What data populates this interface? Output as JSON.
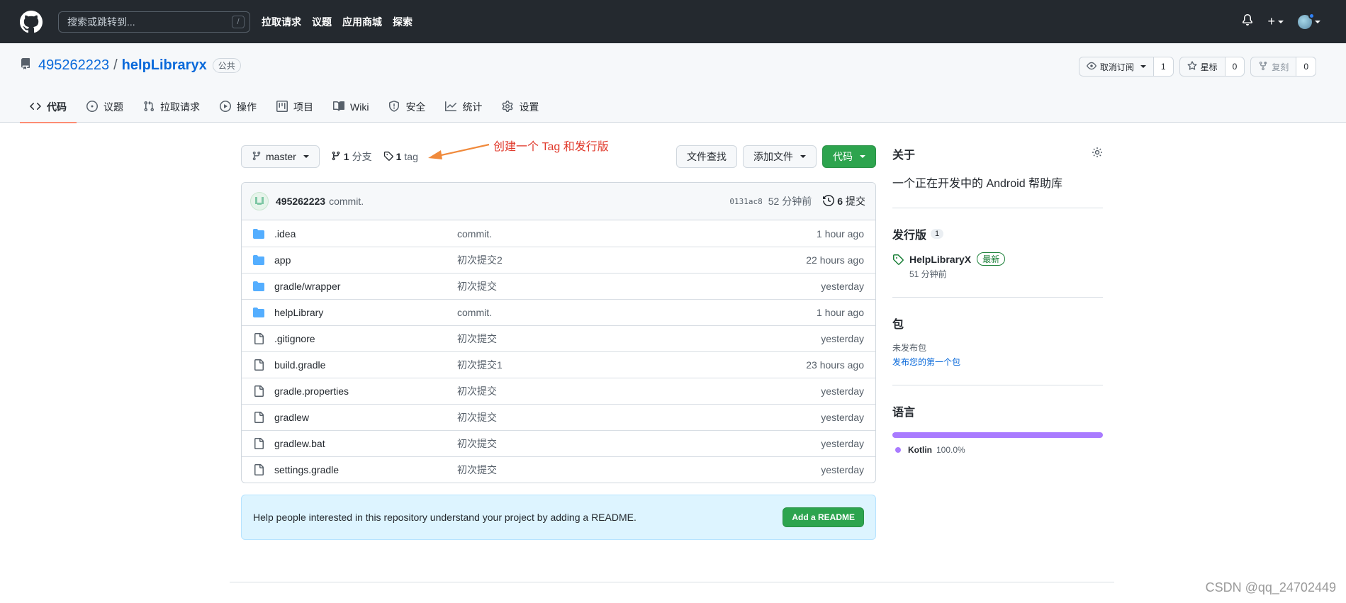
{
  "header": {
    "search_placeholder": "搜索或跳转到...",
    "search_shortcut": "/",
    "nav": [
      "拉取请求",
      "议题",
      "应用商城",
      "探索"
    ],
    "plus_label": "+"
  },
  "repo": {
    "owner": "495262223",
    "separator": "/",
    "name": "helpLibraryx",
    "visibility": "公共",
    "watch_label": "取消订阅",
    "watch_count": "1",
    "star_label": "星标",
    "star_count": "0",
    "fork_label": "复刻",
    "fork_count": "0"
  },
  "tabs": [
    {
      "label": "代码",
      "icon": "code-icon",
      "active": true
    },
    {
      "label": "议题",
      "icon": "issue-icon"
    },
    {
      "label": "拉取请求",
      "icon": "pull-request-icon"
    },
    {
      "label": "操作",
      "icon": "play-icon"
    },
    {
      "label": "项目",
      "icon": "project-icon"
    },
    {
      "label": "Wiki",
      "icon": "book-icon"
    },
    {
      "label": "安全",
      "icon": "shield-icon"
    },
    {
      "label": "统计",
      "icon": "graph-icon"
    },
    {
      "label": "设置",
      "icon": "gear-icon"
    }
  ],
  "branchbar": {
    "branch": "master",
    "branches_count": "1",
    "branches_label": "分支",
    "tags_count": "1",
    "tags_label": "tag",
    "annotation": "创建一个 Tag 和发行版",
    "find_file": "文件查找",
    "add_file": "添加文件",
    "code_button": "代码"
  },
  "latest_commit": {
    "author": "495262223",
    "message": "commit.",
    "sha": "0131ac8",
    "time": "52 分钟前",
    "commits_count": "6",
    "commits_label": "提交"
  },
  "files": [
    {
      "type": "dir",
      "name": ".idea",
      "message": "commit.",
      "age": "1 hour ago"
    },
    {
      "type": "dir",
      "name": "app",
      "message": "初次提交2",
      "age": "22 hours ago"
    },
    {
      "type": "dir",
      "name": "gradle/wrapper",
      "message": "初次提交",
      "age": "yesterday"
    },
    {
      "type": "dir",
      "name": "helpLibrary",
      "message": "commit.",
      "age": "1 hour ago"
    },
    {
      "type": "file",
      "name": ".gitignore",
      "message": "初次提交",
      "age": "yesterday"
    },
    {
      "type": "file",
      "name": "build.gradle",
      "message": "初次提交1",
      "age": "23 hours ago"
    },
    {
      "type": "file",
      "name": "gradle.properties",
      "message": "初次提交",
      "age": "yesterday"
    },
    {
      "type": "file",
      "name": "gradlew",
      "message": "初次提交",
      "age": "yesterday"
    },
    {
      "type": "file",
      "name": "gradlew.bat",
      "message": "初次提交",
      "age": "yesterday"
    },
    {
      "type": "file",
      "name": "settings.gradle",
      "message": "初次提交",
      "age": "yesterday"
    }
  ],
  "readme_banner": {
    "text": "Help people interested in this repository understand your project by adding a README.",
    "button": "Add a README"
  },
  "sidebar": {
    "about_title": "关于",
    "about_desc": "一个正在开发中的 Android 帮助库",
    "releases_title": "发行版",
    "releases_count": "1",
    "release_name": "HelpLibraryX",
    "release_badge": "最新",
    "release_time": "51 分钟前",
    "packages_title": "包",
    "packages_none": "未发布包",
    "packages_link": "发布您的第一个包",
    "languages_title": "语言",
    "language_name": "Kotlin",
    "language_pct": "100.0%",
    "language_color": "#a97bff"
  },
  "watermark": "CSDN @qq_24702449",
  "colors": {
    "header_bg": "#24292f",
    "accent_green": "#2da44e",
    "link_blue": "#0969da",
    "folder_blue": "#54aeff",
    "tab_underline": "#fd8c73",
    "annotation_red": "#e0392b"
  }
}
